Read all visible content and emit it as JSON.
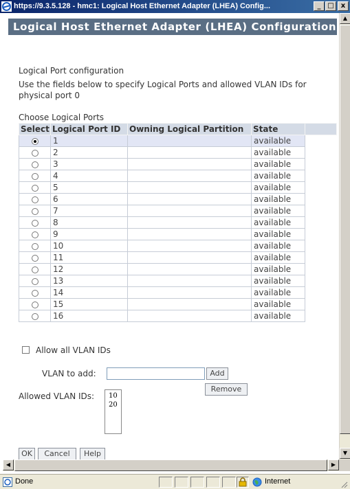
{
  "window": {
    "title": "https://9.3.5.128 - hmc1: Logical Host Ethernet Adapter (LHEA) Config...",
    "minimize": "_",
    "maximize": "□",
    "close": "x"
  },
  "panel": {
    "title": "Logical Host Ethernet Adapter (LHEA) Configuration"
  },
  "section": {
    "heading": "Logical Port configuration",
    "desc_line1": "Use the fields below to specify Logical Ports and allowed VLAN IDs for",
    "desc_line2": "physical port 0",
    "table_caption": "Choose Logical Ports"
  },
  "table": {
    "headers": [
      "Select",
      "Logical Port ID",
      "Owning Logical Partition",
      "State"
    ],
    "selected_index": 0,
    "rows": [
      {
        "id": "1",
        "owner": "",
        "state": "available"
      },
      {
        "id": "2",
        "owner": "",
        "state": "available"
      },
      {
        "id": "3",
        "owner": "",
        "state": "available"
      },
      {
        "id": "4",
        "owner": "",
        "state": "available"
      },
      {
        "id": "5",
        "owner": "",
        "state": "available"
      },
      {
        "id": "6",
        "owner": "",
        "state": "available"
      },
      {
        "id": "7",
        "owner": "",
        "state": "available"
      },
      {
        "id": "8",
        "owner": "",
        "state": "available"
      },
      {
        "id": "9",
        "owner": "",
        "state": "available"
      },
      {
        "id": "10",
        "owner": "",
        "state": "available"
      },
      {
        "id": "11",
        "owner": "",
        "state": "available"
      },
      {
        "id": "12",
        "owner": "",
        "state": "available"
      },
      {
        "id": "13",
        "owner": "",
        "state": "available"
      },
      {
        "id": "14",
        "owner": "",
        "state": "available"
      },
      {
        "id": "15",
        "owner": "",
        "state": "available"
      },
      {
        "id": "16",
        "owner": "",
        "state": "available"
      }
    ]
  },
  "vlan": {
    "allow_all_label": "Allow all VLAN IDs",
    "allow_all_checked": false,
    "add_label": "VLAN to add:",
    "add_value": "",
    "add_button": "Add",
    "remove_button": "Remove",
    "allowed_label": "Allowed VLAN IDs:",
    "allowed_ids": [
      "10",
      "20"
    ]
  },
  "actions": {
    "ok": "OK",
    "cancel": "Cancel",
    "help": "Help"
  },
  "status": {
    "text": "Done",
    "zone": "Internet"
  },
  "colors": {
    "panel_title_bg": "#5a6e84",
    "header_bg": "#d4dbe6",
    "selected_row_bg": "#e2e6f5",
    "titlebar": "#0a246a"
  }
}
